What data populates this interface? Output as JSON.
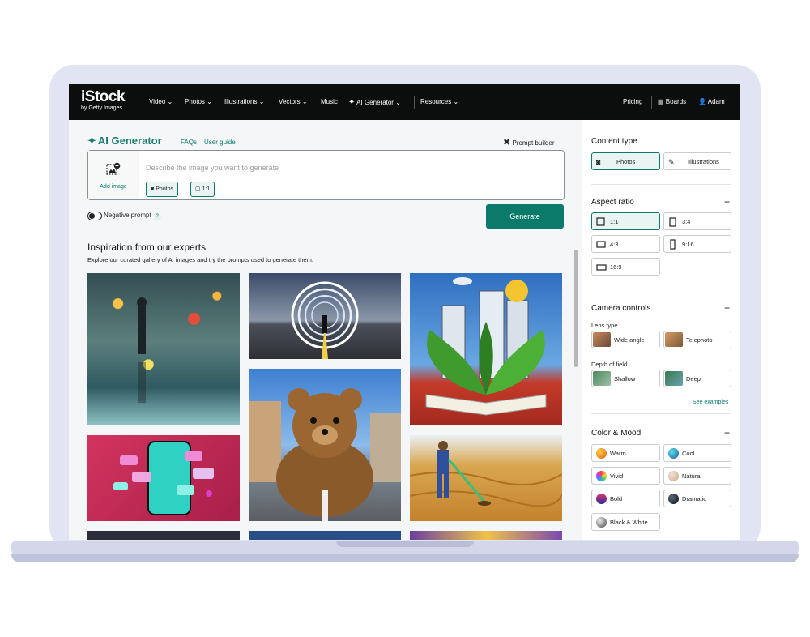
{
  "brand": {
    "name": "iStock",
    "tagline": "by Getty Images"
  },
  "nav": {
    "items": [
      "Video",
      "Photos",
      "Illustrations",
      "Vectors",
      "Music",
      "AI Generator",
      "Resources"
    ],
    "right": {
      "pricing": "Pricing",
      "boards": "Boards",
      "user": "Adam"
    }
  },
  "generator": {
    "title": "AI Generator",
    "faqs": "FAQs",
    "guide": "User guide",
    "prompt_builder": "Prompt builder",
    "add_image": "Add image",
    "placeholder": "Describe the image you want to generate",
    "chip_type": "Photos",
    "chip_ratio": "1:1",
    "negative_prompt": "Negative prompt",
    "help": "?",
    "generate": "Generate"
  },
  "inspiration": {
    "title": "Inspiration from our experts",
    "subtitle": "Explore our curated gallery of AI images and try the prompts used to generate them."
  },
  "sidebar": {
    "content_type": {
      "title": "Content type",
      "options": [
        "Photos",
        "Illustrations"
      ],
      "selected": "Photos"
    },
    "aspect_ratio": {
      "title": "Aspect ratio",
      "options": [
        "1:1",
        "3:4",
        "4:3",
        "9:16",
        "16:9"
      ],
      "selected": "1:1"
    },
    "camera": {
      "title": "Camera controls",
      "lens_label": "Lens type",
      "lens": [
        "Wide angle",
        "Telephoto"
      ],
      "depth_label": "Depth of field",
      "depth": [
        "Shallow",
        "Deep"
      ],
      "see_examples": "See examples"
    },
    "color_mood": {
      "title": "Color & Mood",
      "options": [
        "Warm",
        "Cool",
        "Vivid",
        "Natural",
        "Bold",
        "Dramatic",
        "Black & White"
      ]
    },
    "collapse": "−"
  },
  "colors": {
    "accent": "#0b7a6a",
    "nav_bg": "#0c0d0d",
    "frame": "#e1e4f3"
  }
}
